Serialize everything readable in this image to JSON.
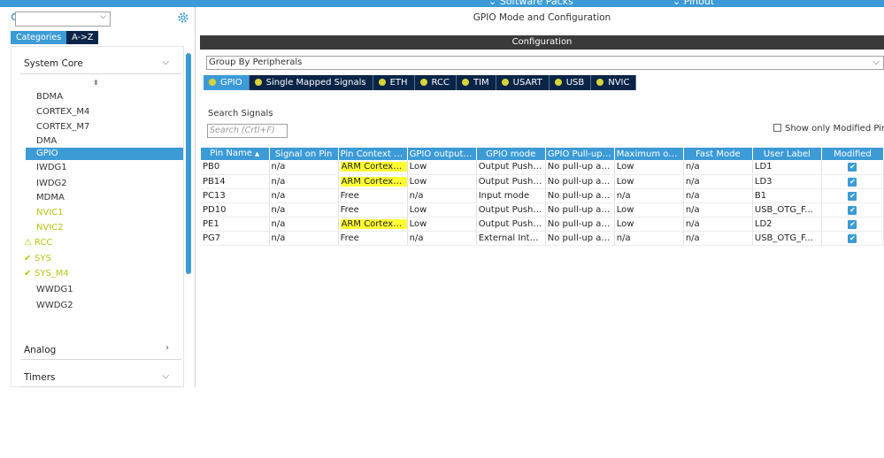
{
  "topbar": {
    "software_packs": "Software Packs",
    "pinout": "Pinout"
  },
  "left": {
    "category_tab": "Categories",
    "az_tab": "A->Z",
    "system_core": "System Core",
    "items": [
      "BDMA",
      "CORTEX_M4",
      "CORTEX_M7",
      "DMA",
      "GPIO",
      "IWDG1",
      "IWDG2",
      "MDMA",
      "NVIC1",
      "NVIC2",
      "RCC",
      "SYS",
      "SYS_M4",
      "WWDG1",
      "WWDG2"
    ],
    "analog": "Analog",
    "timers": "Timers"
  },
  "right": {
    "title": "GPIO Mode and Configuration",
    "configuration": "Configuration",
    "group_by": "Group By Peripherals",
    "tabs": [
      "GPIO",
      "Single Mapped Signals",
      "ETH",
      "RCC",
      "TIM",
      "USART",
      "USB",
      "NVIC"
    ],
    "search_label": "Search Signals",
    "search_placeholder": "Search (Crtl+F)",
    "only_modified": "Show only Modified Pins"
  },
  "table": {
    "headers": [
      "Pin Name",
      "Signal on Pin",
      "Pin Context A...",
      "GPIO output l...",
      "GPIO mode",
      "GPIO Pull-up/...",
      "Maximum out...",
      "Fast Mode",
      "User Label",
      "Modified"
    ],
    "rows": [
      [
        "PB0",
        "n/a",
        "ARM Cortex-M7",
        "Low",
        "Output Push ...",
        "No pull-up an...",
        "Low",
        "n/a",
        "LD1"
      ],
      [
        "PB14",
        "n/a",
        "ARM Cortex-M7",
        "Low",
        "Output Push ...",
        "No pull-up an...",
        "Low",
        "n/a",
        "LD3"
      ],
      [
        "PC13",
        "n/a",
        "Free",
        "n/a",
        "Input mode",
        "No pull-up an...",
        "n/a",
        "n/a",
        "B1"
      ],
      [
        "PD10",
        "n/a",
        "Free",
        "Low",
        "Output Push ...",
        "No pull-up an...",
        "Low",
        "n/a",
        "USB_OTG_F..."
      ],
      [
        "PE1",
        "n/a",
        "ARM Cortex-M7",
        "Low",
        "Output Push ...",
        "No pull-up an...",
        "Low",
        "n/a",
        "LD2"
      ],
      [
        "PG7",
        "n/a",
        "Free",
        "n/a",
        "External Interr...",
        "No pull-up an...",
        "n/a",
        "n/a",
        "USB_OTG_F..."
      ]
    ]
  },
  "colors": {
    "accent": "#3c9bd6",
    "dark_tab": "#0b2548",
    "warning": "#b7c512",
    "highlight": "#ffff33"
  }
}
